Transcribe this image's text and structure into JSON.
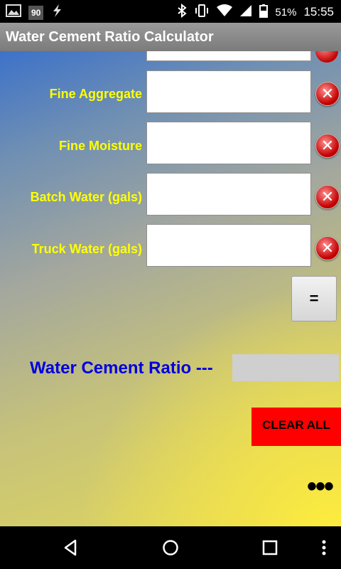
{
  "status_bar": {
    "badge_90": "90",
    "battery_percent": "51%",
    "time": "15:55"
  },
  "app": {
    "title": "Water Cement Ratio Calculator"
  },
  "fields": [
    {
      "label": "Fine Aggregate",
      "value": ""
    },
    {
      "label": "Fine Moisture",
      "value": ""
    },
    {
      "label": "Batch Water (gals)",
      "value": ""
    },
    {
      "label": "Truck Water (gals)",
      "value": ""
    }
  ],
  "buttons": {
    "equals_label": "=",
    "clear_all_label": "CLEAR ALL",
    "more_label": "•••"
  },
  "result": {
    "label": "Water Cement Ratio ---",
    "value": ""
  },
  "icons": {
    "clear_field": "clear-x-icon",
    "nav_back": "back-triangle-icon",
    "nav_home": "home-circle-icon",
    "nav_recents": "recents-square-icon",
    "nav_menu": "overflow-menu-icon"
  },
  "colors": {
    "label_yellow": "#ffff00",
    "result_blue": "#0000e0",
    "clear_all_red": "#ff0000"
  }
}
